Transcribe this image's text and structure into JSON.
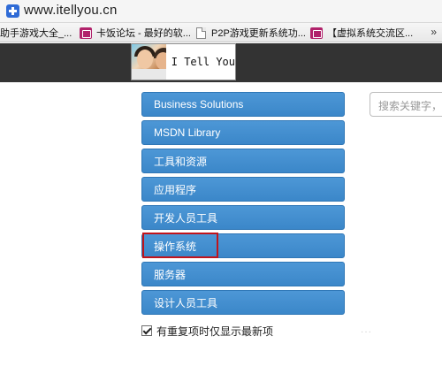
{
  "browser": {
    "url": "www.itellyou.cn",
    "bookmarks": [
      {
        "label": "助手游戏大全_...",
        "icon": "none"
      },
      {
        "label": "卡饭论坛 - 最好的软...",
        "icon": "bookmark-favicon-icon"
      },
      {
        "label": "P2P游戏更新系统功...",
        "icon": "page-icon"
      },
      {
        "label": "【虚拟系统交流区...",
        "icon": "bookmark-favicon-icon"
      }
    ],
    "more": "»"
  },
  "header": {
    "logo_text": "I Tell You"
  },
  "search": {
    "placeholder": "搜索关键字，"
  },
  "menu": {
    "items": [
      {
        "label": "Business Solutions"
      },
      {
        "label": "MSDN Library"
      },
      {
        "label": "工具和资源"
      },
      {
        "label": "应用程序"
      },
      {
        "label": "开发人员工具"
      },
      {
        "label": "操作系统"
      },
      {
        "label": "服务器"
      },
      {
        "label": "设计人员工具"
      }
    ]
  },
  "options": {
    "latest_only_label": "有重复项时仅显示最新项",
    "latest_only_checked": true
  },
  "colors": {
    "header_bg": "#333333",
    "menu_button": "#4290d0",
    "highlight": "#c0141c"
  }
}
